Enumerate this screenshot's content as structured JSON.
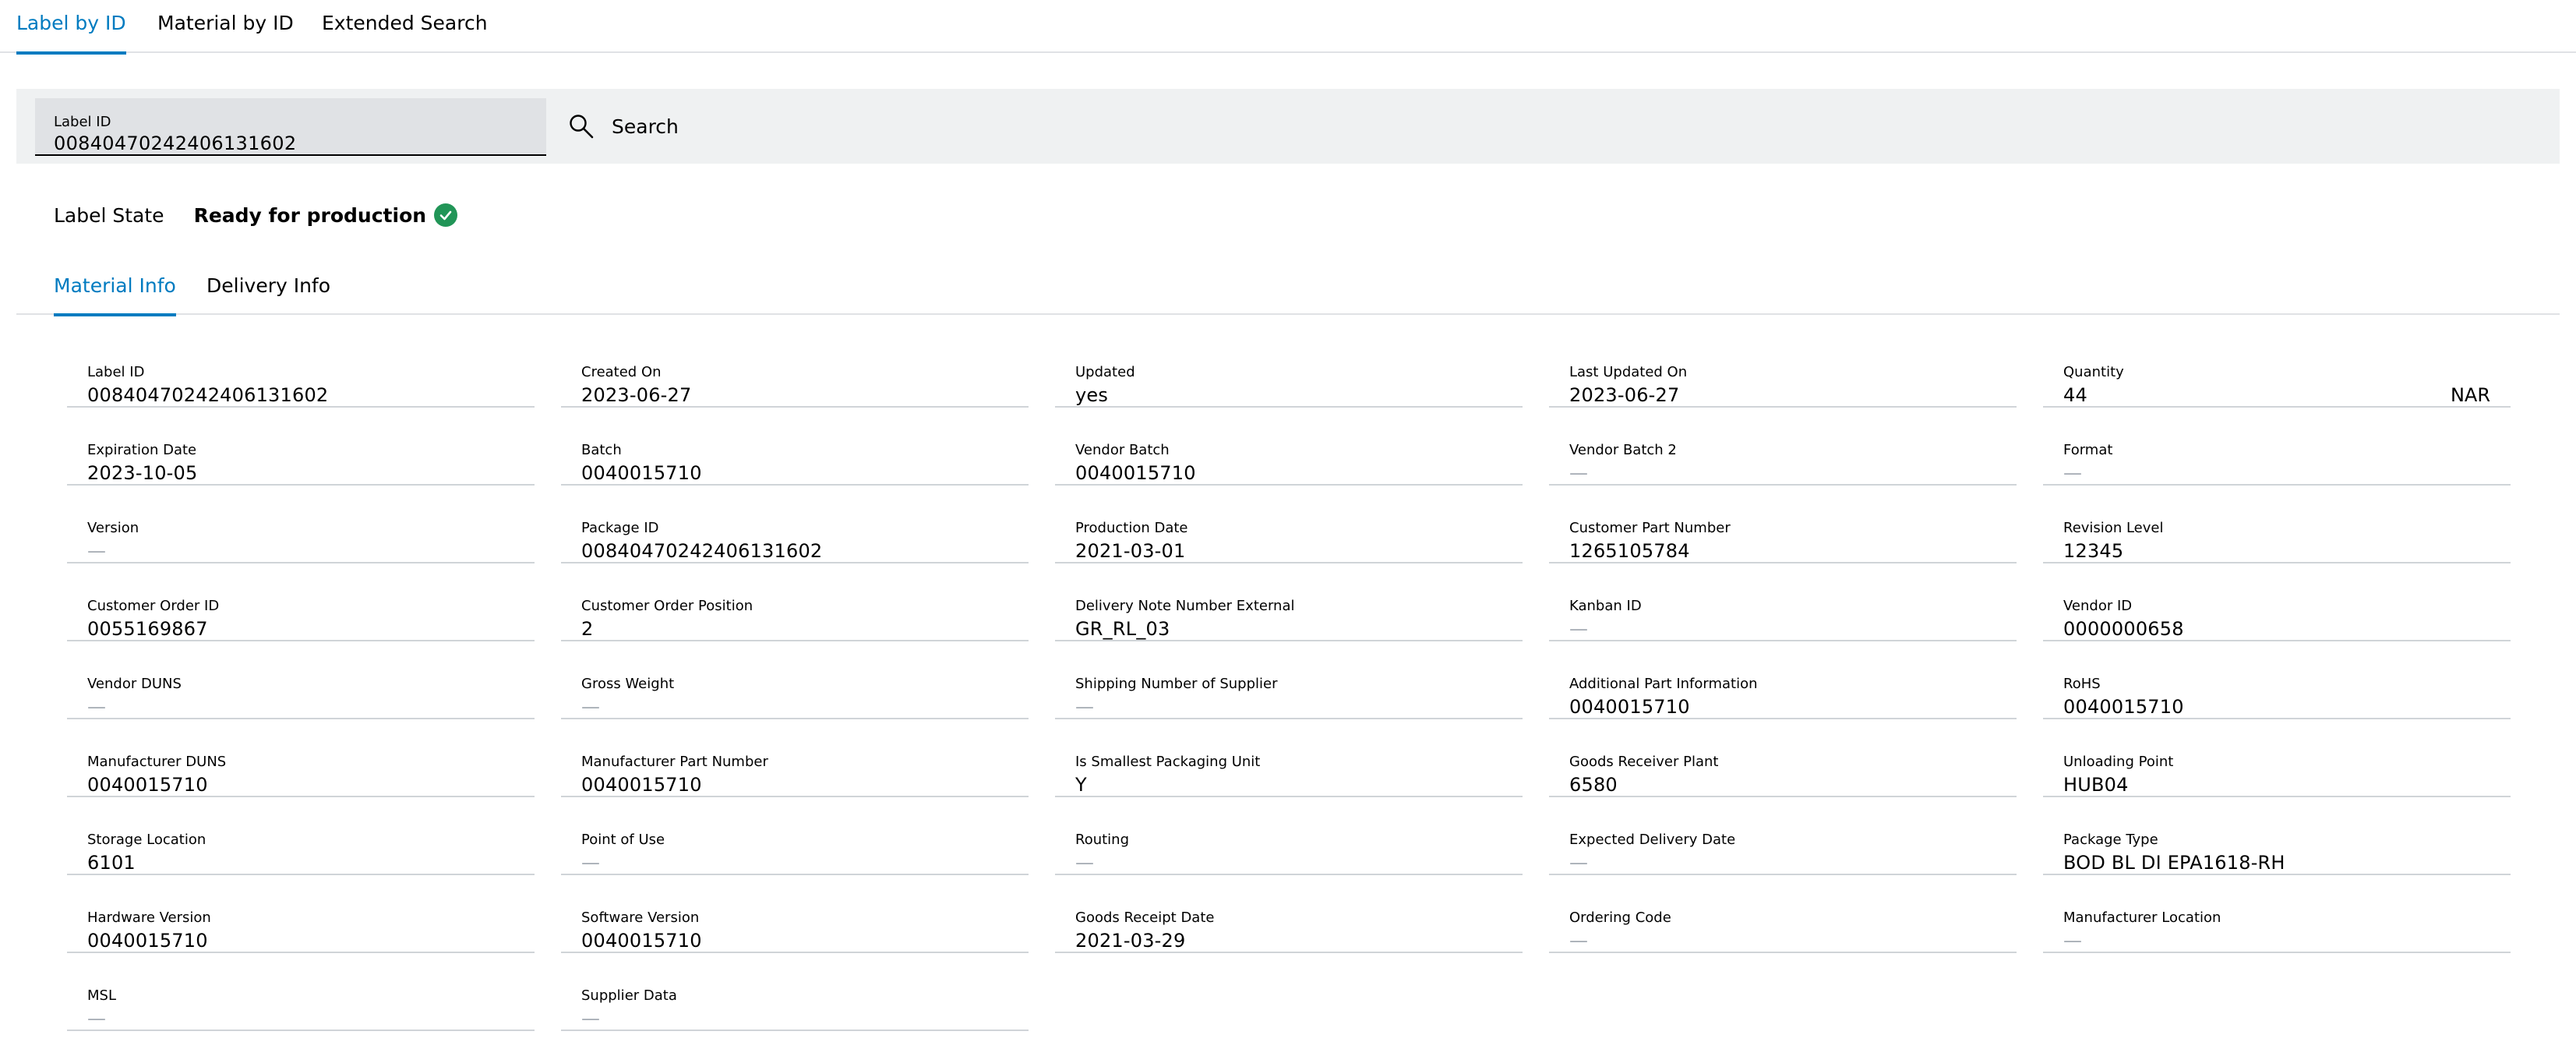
{
  "top_tabs": [
    {
      "label": "Label by ID",
      "active": true
    },
    {
      "label": "Material by ID",
      "active": false
    },
    {
      "label": "Extended Search",
      "active": false
    }
  ],
  "search": {
    "field_label": "Label ID",
    "value": "00840470242406131602",
    "button_label": "Search"
  },
  "label_state": {
    "label": "Label State",
    "value": "Ready for production",
    "icon": "check-circle-icon",
    "color": "#219557"
  },
  "sub_tabs": [
    {
      "label": "Material Info",
      "active": true
    },
    {
      "label": "Delivery Info",
      "active": false
    }
  ],
  "accent_color": "#007bc0",
  "fields": [
    {
      "label": "Label ID",
      "value": "00840470242406131602"
    },
    {
      "label": "Created On",
      "value": "2023-06-27"
    },
    {
      "label": "Updated",
      "value": "yes"
    },
    {
      "label": "Last Updated On",
      "value": "2023-06-27"
    },
    {
      "label": "Quantity",
      "value": "44",
      "unit": "NAR"
    },
    {
      "label": "Expiration Date",
      "value": "2023-10-05"
    },
    {
      "label": "Batch",
      "value": "0040015710"
    },
    {
      "label": "Vendor Batch",
      "value": "0040015710"
    },
    {
      "label": "Vendor Batch 2",
      "value": "—"
    },
    {
      "label": "Format",
      "value": "—"
    },
    {
      "label": "Version",
      "value": "—"
    },
    {
      "label": "Package ID",
      "value": "00840470242406131602"
    },
    {
      "label": "Production Date",
      "value": "2021-03-01"
    },
    {
      "label": "Customer Part Number",
      "value": "1265105784"
    },
    {
      "label": "Revision Level",
      "value": "12345"
    },
    {
      "label": "Customer Order ID",
      "value": "0055169867"
    },
    {
      "label": "Customer Order Position",
      "value": "2"
    },
    {
      "label": "Delivery Note Number External",
      "value": "GR_RL_03"
    },
    {
      "label": "Kanban ID",
      "value": "—"
    },
    {
      "label": "Vendor ID",
      "value": "0000000658"
    },
    {
      "label": "Vendor DUNS",
      "value": "—"
    },
    {
      "label": "Gross Weight",
      "value": "—"
    },
    {
      "label": "Shipping Number of Supplier",
      "value": "—"
    },
    {
      "label": "Additional Part Information",
      "value": "0040015710"
    },
    {
      "label": "RoHS",
      "value": "0040015710"
    },
    {
      "label": "Manufacturer DUNS",
      "value": "0040015710"
    },
    {
      "label": "Manufacturer Part Number",
      "value": "0040015710"
    },
    {
      "label": "Is Smallest Packaging Unit",
      "value": "Y"
    },
    {
      "label": "Goods Receiver Plant",
      "value": "6580"
    },
    {
      "label": "Unloading Point",
      "value": "HUB04"
    },
    {
      "label": "Storage Location",
      "value": "6101"
    },
    {
      "label": "Point of Use",
      "value": "—"
    },
    {
      "label": "Routing",
      "value": "—"
    },
    {
      "label": "Expected Delivery Date",
      "value": "—"
    },
    {
      "label": "Package Type",
      "value": "BOD BL DI EPA1618-RH"
    },
    {
      "label": "Hardware Version",
      "value": "0040015710"
    },
    {
      "label": "Software Version",
      "value": "0040015710"
    },
    {
      "label": "Goods Receipt Date",
      "value": "2021-03-29"
    },
    {
      "label": "Ordering Code",
      "value": "—"
    },
    {
      "label": "Manufacturer Location",
      "value": "—"
    },
    {
      "label": "MSL",
      "value": "—"
    },
    {
      "label": "Supplier Data",
      "value": "—"
    }
  ]
}
